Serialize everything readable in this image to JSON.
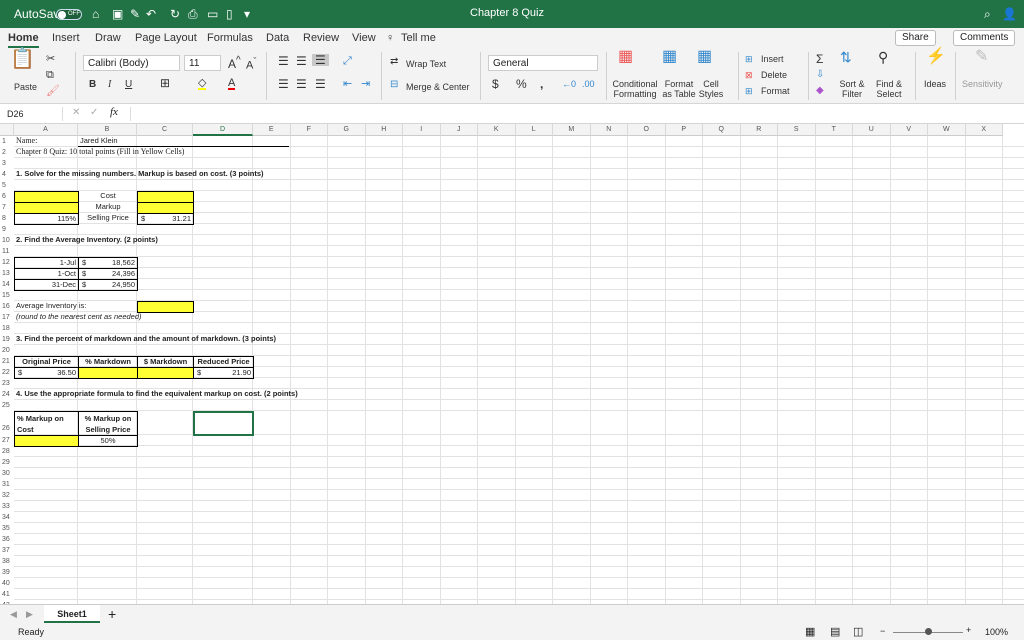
{
  "titlebar": {
    "autosave": "AutoSave",
    "toggle": "OFF",
    "title": "Chapter 8 Quiz",
    "accent": "#217346"
  },
  "tabs": [
    "Home",
    "Insert",
    "Draw",
    "Page Layout",
    "Formulas",
    "Data",
    "Review",
    "View",
    "Tell me"
  ],
  "share": "Share",
  "comments": "Comments",
  "ribbon": {
    "paste": "Paste",
    "font": "Calibri (Body)",
    "size": "11",
    "wrap": "Wrap Text",
    "merge": "Merge & Center",
    "number_format": "General",
    "conditional": "Conditional Formatting",
    "format_table": "Format as Table",
    "cell_styles": "Cell Styles",
    "insert": "Insert",
    "delete": "Delete",
    "format": "Format",
    "sort": "Sort & Filter",
    "find": "Find & Select",
    "ideas": "Ideas",
    "sensitivity": "Sensitivity"
  },
  "formula_bar": {
    "name_box": "D26",
    "fx": "fx",
    "value": ""
  },
  "columns": [
    "A",
    "B",
    "C",
    "D",
    "E",
    "F",
    "G",
    "H",
    "I",
    "J",
    "K",
    "L",
    "M",
    "N",
    "O",
    "P",
    "Q",
    "R",
    "S",
    "T",
    "U",
    "V",
    "W",
    "X"
  ],
  "cells": [
    {
      "ref": "A1",
      "text": "Name:",
      "s": "serif"
    },
    {
      "ref": "B1",
      "text": "Jared Klein",
      "s": ""
    },
    {
      "ref": "A2",
      "text": "Chapter 8 Quiz: 10 total points (Fill in Yellow Cells)",
      "s": "serif"
    },
    {
      "ref": "A4",
      "text": "1. Solve for the missing numbers.  Markup is based on cost. (3 points)",
      "s": "b"
    },
    {
      "ref": "A6",
      "text": "",
      "s": "yellow box"
    },
    {
      "ref": "B6",
      "text": "Cost",
      "s": "c"
    },
    {
      "ref": "C6",
      "text": "",
      "s": "yellow box"
    },
    {
      "ref": "A7",
      "text": "",
      "s": "yellow box"
    },
    {
      "ref": "B7",
      "text": "Markup",
      "s": "c"
    },
    {
      "ref": "C7",
      "text": "",
      "s": "yellow box"
    },
    {
      "ref": "A8",
      "text": "115%",
      "s": "r box"
    },
    {
      "ref": "B8",
      "text": "Selling Price",
      "s": "c"
    },
    {
      "ref": "C8",
      "text": "31.21",
      "dollar": "$",
      "s": "r box"
    },
    {
      "ref": "A10",
      "text": "2. Find the Average Inventory. (2 points)",
      "s": "b"
    },
    {
      "ref": "A12",
      "text": "1-Jul",
      "s": "r box"
    },
    {
      "ref": "B12",
      "text": "18,562",
      "dollar": "$",
      "s": "r box"
    },
    {
      "ref": "A13",
      "text": "1-Oct",
      "s": "r box"
    },
    {
      "ref": "B13",
      "text": "24,396",
      "dollar": "$",
      "s": "r box"
    },
    {
      "ref": "A14",
      "text": "31-Dec",
      "s": "r box"
    },
    {
      "ref": "B14",
      "text": "24,950",
      "dollar": "$",
      "s": "r box"
    },
    {
      "ref": "A16",
      "text": "Average Inventory is:",
      "s": ""
    },
    {
      "ref": "C16",
      "text": "",
      "s": "yellow box"
    },
    {
      "ref": "A17",
      "text": "(round to the nearest cent as needed)",
      "s": "i"
    },
    {
      "ref": "A19",
      "text": "3. Find the percent of markdown and the amount of markdown. (3 points)",
      "s": "b"
    },
    {
      "ref": "A21",
      "text": "Original Price",
      "s": "b c box"
    },
    {
      "ref": "B21",
      "text": "% Markdown",
      "s": "b c box"
    },
    {
      "ref": "C21",
      "text": "$ Markdown",
      "s": "b c box"
    },
    {
      "ref": "D21",
      "text": "Reduced Price",
      "s": "b c box"
    },
    {
      "ref": "A22",
      "text": "36.50",
      "dollar": "$",
      "s": "r box"
    },
    {
      "ref": "B22",
      "text": "",
      "s": "yellow box"
    },
    {
      "ref": "C22",
      "text": "",
      "s": "yellow box"
    },
    {
      "ref": "D22",
      "text": "21.90",
      "dollar": "$",
      "s": "r box"
    },
    {
      "ref": "A24",
      "text": "4. Use the appropriate formula to find the equivalent markup on cost. (2 points)",
      "s": "b"
    },
    {
      "ref": "A26",
      "text": "% Markup on Cost",
      "s": "b box"
    },
    {
      "ref": "B26",
      "text": "% Markup on Selling Price",
      "s": "b c box"
    },
    {
      "ref": "A27",
      "text": "",
      "s": "yellow box"
    },
    {
      "ref": "B27",
      "text": "50%",
      "s": "c box"
    }
  ],
  "selected_cell": "D26",
  "sheet_tab": "Sheet1",
  "status": {
    "ready": "Ready",
    "zoom": "100%"
  }
}
